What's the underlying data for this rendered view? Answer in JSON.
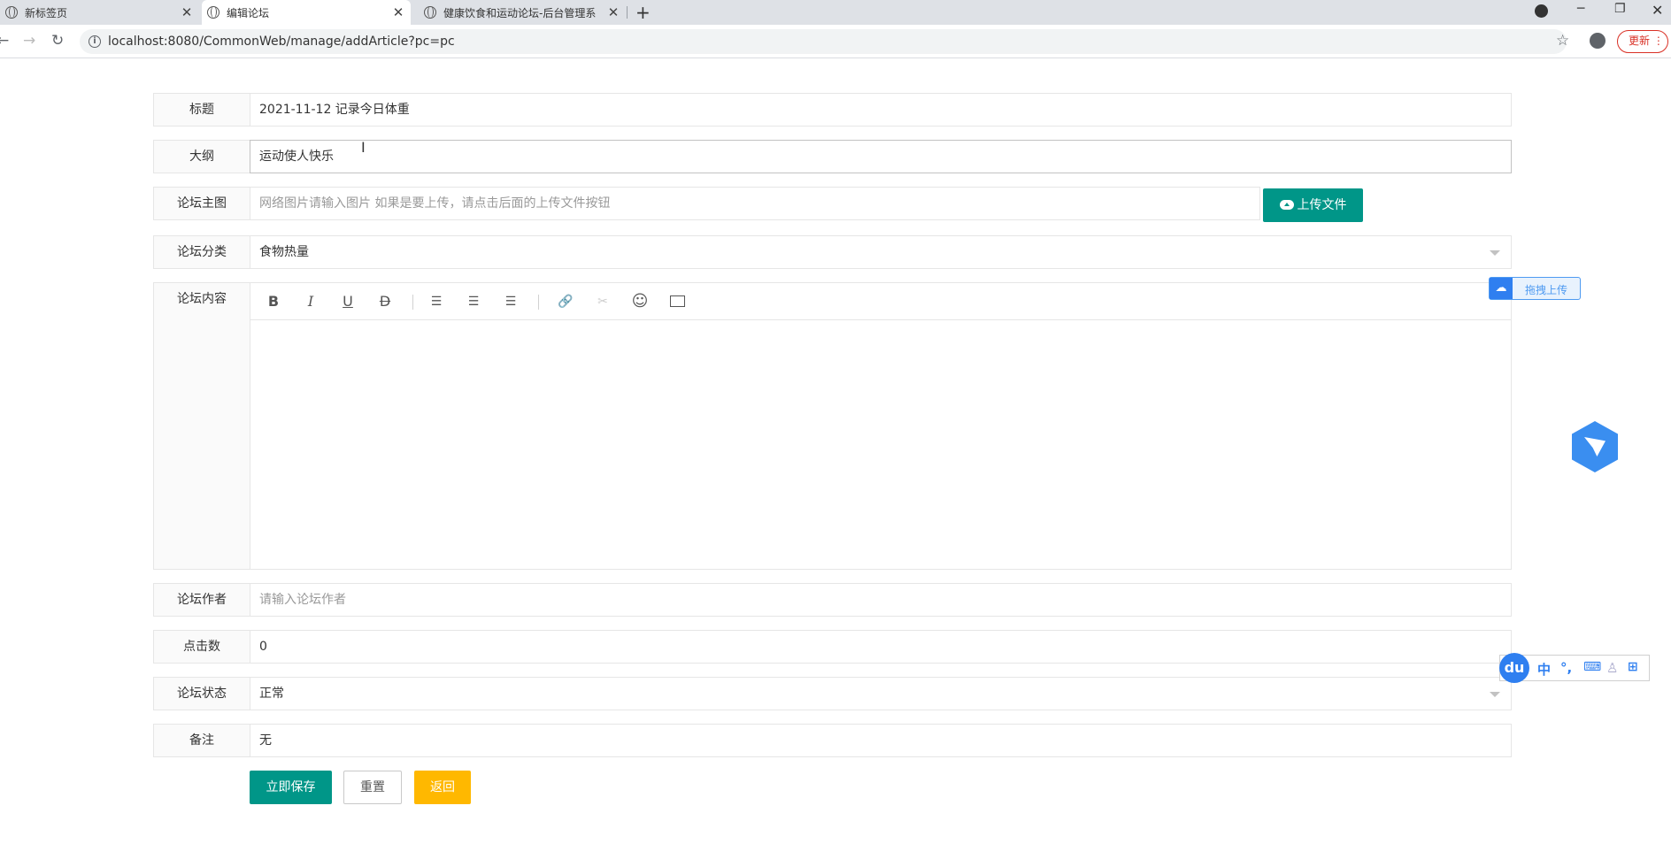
{
  "browser": {
    "tabs": [
      {
        "title": "新标签页"
      },
      {
        "title": "编辑论坛"
      },
      {
        "title": "健康饮食和运动论坛-后台管理系"
      }
    ],
    "url": "localhost:8080/CommonWeb/manage/addArticle?pc=pc",
    "update_label": "更新"
  },
  "form": {
    "title": {
      "label": "标题",
      "value": "2021-11-12 记录今日体重"
    },
    "outline": {
      "label": "大纲",
      "value": "运动使人快乐"
    },
    "main_image": {
      "label": "论坛主图",
      "placeholder": "网络图片请输入图片 如果是要上传，请点击后面的上传文件按钮",
      "upload_label": "上传文件"
    },
    "category": {
      "label": "论坛分类",
      "value": "食物热量"
    },
    "content": {
      "label": "论坛内容",
      "toolbar": [
        "B",
        "I",
        "U",
        "D"
      ]
    },
    "author": {
      "label": "论坛作者",
      "placeholder": "请输入论坛作者"
    },
    "clicks": {
      "label": "点击数",
      "value": "0"
    },
    "status": {
      "label": "论坛状态",
      "value": "正常"
    },
    "remark": {
      "label": "备注",
      "value": "无"
    },
    "buttons": {
      "save": "立即保存",
      "reset": "重置",
      "back": "返回"
    }
  },
  "widgets": {
    "drag_upload_label": "拖拽上传",
    "ime": {
      "logo": "du",
      "items": [
        "中",
        "°,"
      ]
    }
  },
  "colors": {
    "primary": "#009688",
    "warm": "#ffb800",
    "baidu_blue": "#2f7ff0"
  }
}
